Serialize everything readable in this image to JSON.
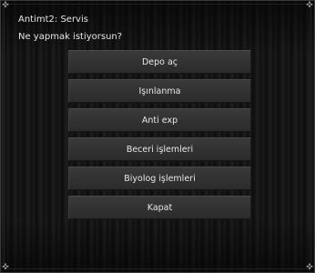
{
  "dialog": {
    "title": "Antimt2: Servis",
    "question": "Ne yapmak istiyorsun?",
    "options": [
      {
        "label": "Depo aç"
      },
      {
        "label": "Işınlanma"
      },
      {
        "label": "Anti exp"
      },
      {
        "label": "Beceri işlemleri"
      },
      {
        "label": "Biyolog işlemleri"
      },
      {
        "label": "Kapat"
      }
    ]
  },
  "theme": {
    "background": "#0c0c0c",
    "button_color": "#333333",
    "text_color": "#e6e6e6"
  }
}
